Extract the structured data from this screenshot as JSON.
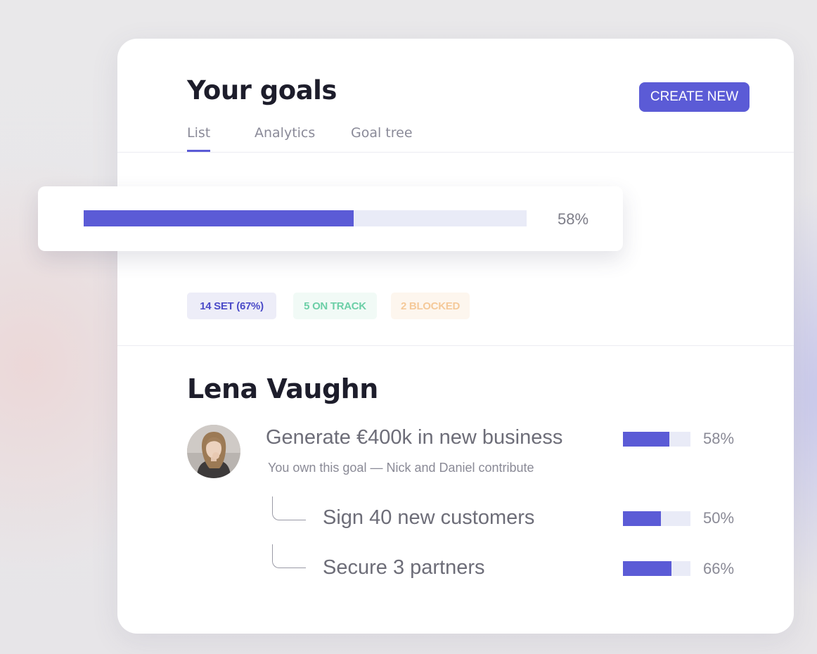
{
  "header": {
    "title": "Your goals",
    "create_button": "CREATE NEW"
  },
  "tabs": [
    {
      "label": "List",
      "active": true
    },
    {
      "label": "Analytics",
      "active": false
    },
    {
      "label": "Goal tree",
      "active": false
    }
  ],
  "overall_progress": {
    "percent_label": "58%",
    "fraction": 0.61
  },
  "badges": [
    {
      "label": "14 SET (67%)",
      "text_color": "#4b4bc8",
      "bg_color": "#ededf8"
    },
    {
      "label": "5 ON TRACK",
      "text_color": "#6ccfa7",
      "bg_color": "#f1faf6"
    },
    {
      "label": "2 BLOCKED",
      "text_color": "#f5c999",
      "bg_color": "#fdf6ee"
    }
  ],
  "person": {
    "name": "Lena Vaughn",
    "avatar_icon": "person-photo"
  },
  "main_goal": {
    "title": "Generate €400k in new business",
    "note": "You own this goal — Nick and Daniel contribute",
    "percent_label": "58%",
    "fraction": 0.69
  },
  "sub_goals": [
    {
      "title": "Sign 40 new customers",
      "percent_label": "50%",
      "fraction": 0.56
    },
    {
      "title": "Secure 3 partners",
      "percent_label": "66%",
      "fraction": 0.72
    }
  ],
  "colors": {
    "accent": "#5b5bd6",
    "track": "#e9ebf7"
  }
}
